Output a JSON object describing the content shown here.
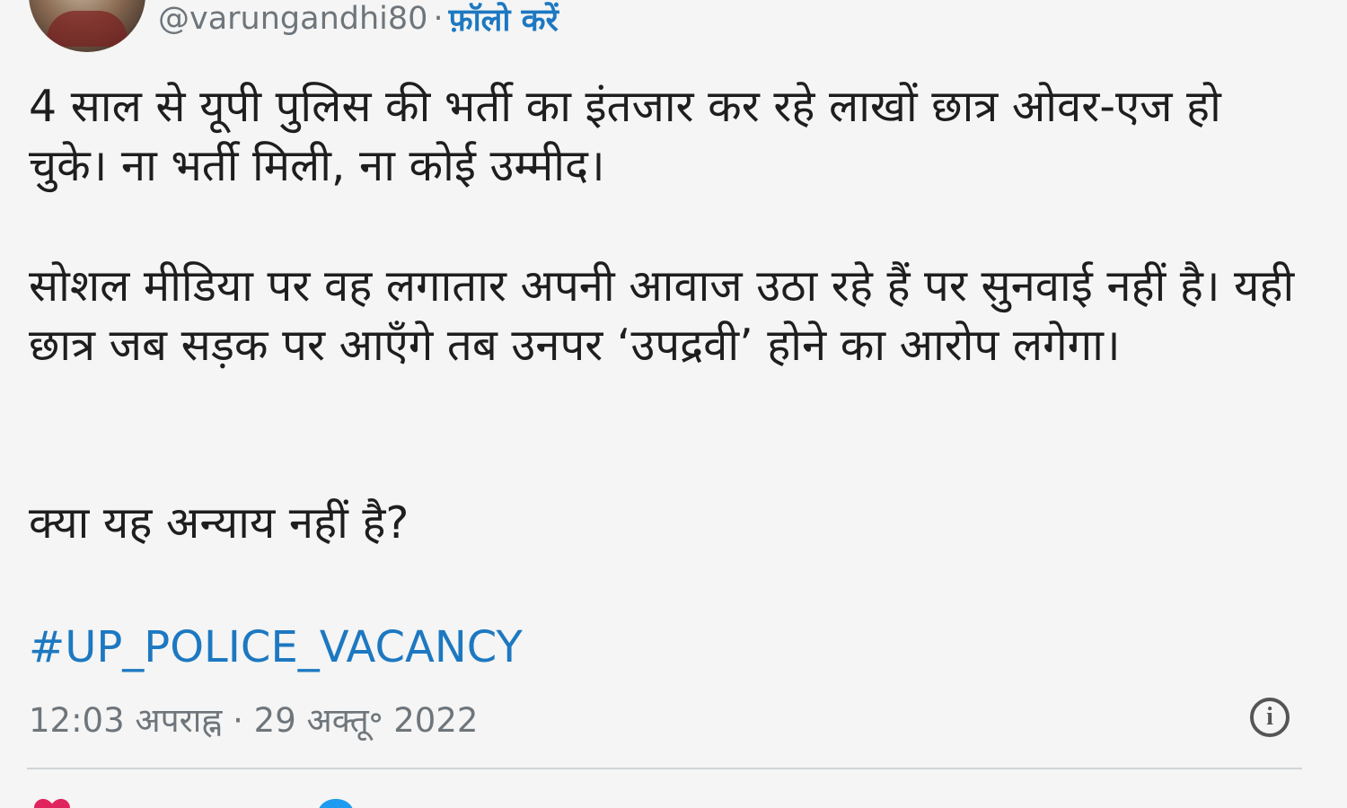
{
  "tweet": {
    "handle": "@varungandhi80",
    "separator": "·",
    "follow_label": "फ़ॉलो करें",
    "paragraphs": [
      "4 साल से यूपी पुलिस की भर्ती का इंतजार कर रहे लाखों छात्र ओवर-एज हो चुके। ना भर्ती मिली, ना कोई उम्मीद।",
      "सोशल मीडिया पर वह लगातार अपनी आवाज उठा रहे हैं पर सुनवाई नहीं है। यही छात्र जब सड़क पर आएँगे तब उनपर ‘उपद्रवी’ होने का आरोप लगेगा।",
      "क्या यह अन्याय नहीं है?"
    ],
    "hashtag": "#UP_POLICE_VACANCY",
    "timestamp": "12:03 अपराह्न · 29 अक्तू॰ 2022",
    "info_icon_glyph": "i"
  },
  "icons": {
    "avatar": "avatar",
    "info": "info-icon",
    "like": "heart-icon",
    "reply": "reply-icon"
  },
  "colors": {
    "link": "#1d78c1",
    "muted": "#6e757b",
    "like": "#e0245e",
    "reply": "#1d9bf0"
  }
}
